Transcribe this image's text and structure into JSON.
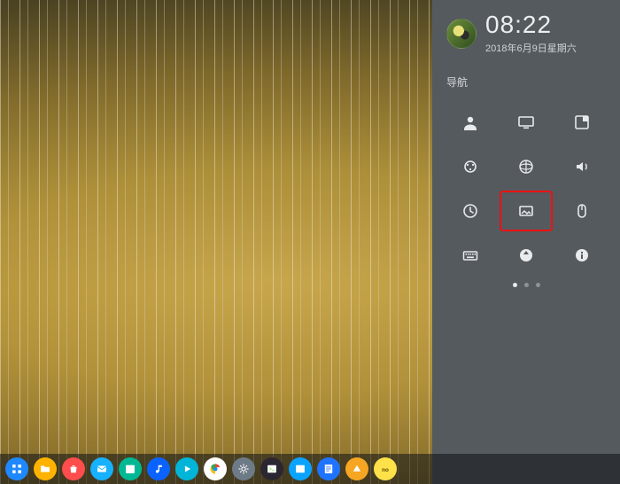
{
  "clock": {
    "time": "08:22",
    "date": "2018年6月9日星期六"
  },
  "panel": {
    "section_title": "导航",
    "tiles": [
      {
        "id": "account",
        "name": "account-icon"
      },
      {
        "id": "display",
        "name": "display-icon"
      },
      {
        "id": "defaultapps",
        "name": "default-apps-icon"
      },
      {
        "id": "personalize",
        "name": "personalization-icon"
      },
      {
        "id": "network",
        "name": "network-icon"
      },
      {
        "id": "sound",
        "name": "sound-icon"
      },
      {
        "id": "datetime",
        "name": "time-date-icon"
      },
      {
        "id": "wallpaper",
        "name": "wallpaper-icon",
        "highlight": true
      },
      {
        "id": "mouse",
        "name": "mouse-icon"
      },
      {
        "id": "keyboard",
        "name": "keyboard-icon"
      },
      {
        "id": "update",
        "name": "update-icon"
      },
      {
        "id": "sysinfo",
        "name": "system-info-icon"
      }
    ],
    "pager": {
      "count": 3,
      "active": 0
    }
  },
  "dock": [
    {
      "id": "launcher",
      "name": "launcher-icon",
      "bg": "#1e88ff"
    },
    {
      "id": "files",
      "name": "file-manager-icon",
      "bg": "#ffb300"
    },
    {
      "id": "store",
      "name": "app-store-icon",
      "bg": "#ff4d4d"
    },
    {
      "id": "mail",
      "name": "mail-icon",
      "bg": "#17b1ff"
    },
    {
      "id": "calendar",
      "name": "calendar-icon",
      "bg": "#00b894"
    },
    {
      "id": "music",
      "name": "music-player-icon",
      "bg": "#0b63ff"
    },
    {
      "id": "video",
      "name": "video-player-icon",
      "bg": "#00b5d8"
    },
    {
      "id": "chrome",
      "name": "chrome-icon",
      "bg": "#ffffff"
    },
    {
      "id": "settings",
      "name": "settings-gear-icon",
      "bg": "#6d7b87"
    },
    {
      "id": "terminal",
      "name": "terminal-icon",
      "bg": "#2b2730"
    },
    {
      "id": "monitor",
      "name": "system-monitor-icon",
      "bg": "#0aa3ff"
    },
    {
      "id": "editor",
      "name": "text-editor-icon",
      "bg": "#1f74ff"
    },
    {
      "id": "safe",
      "name": "safe-remove-icon",
      "bg": "#f6a623"
    },
    {
      "id": "wps",
      "name": "noto-app-icon",
      "bg": "#ffe14a"
    }
  ],
  "colors": {
    "panel_bg": "#555a5f",
    "highlight": "#e11"
  }
}
